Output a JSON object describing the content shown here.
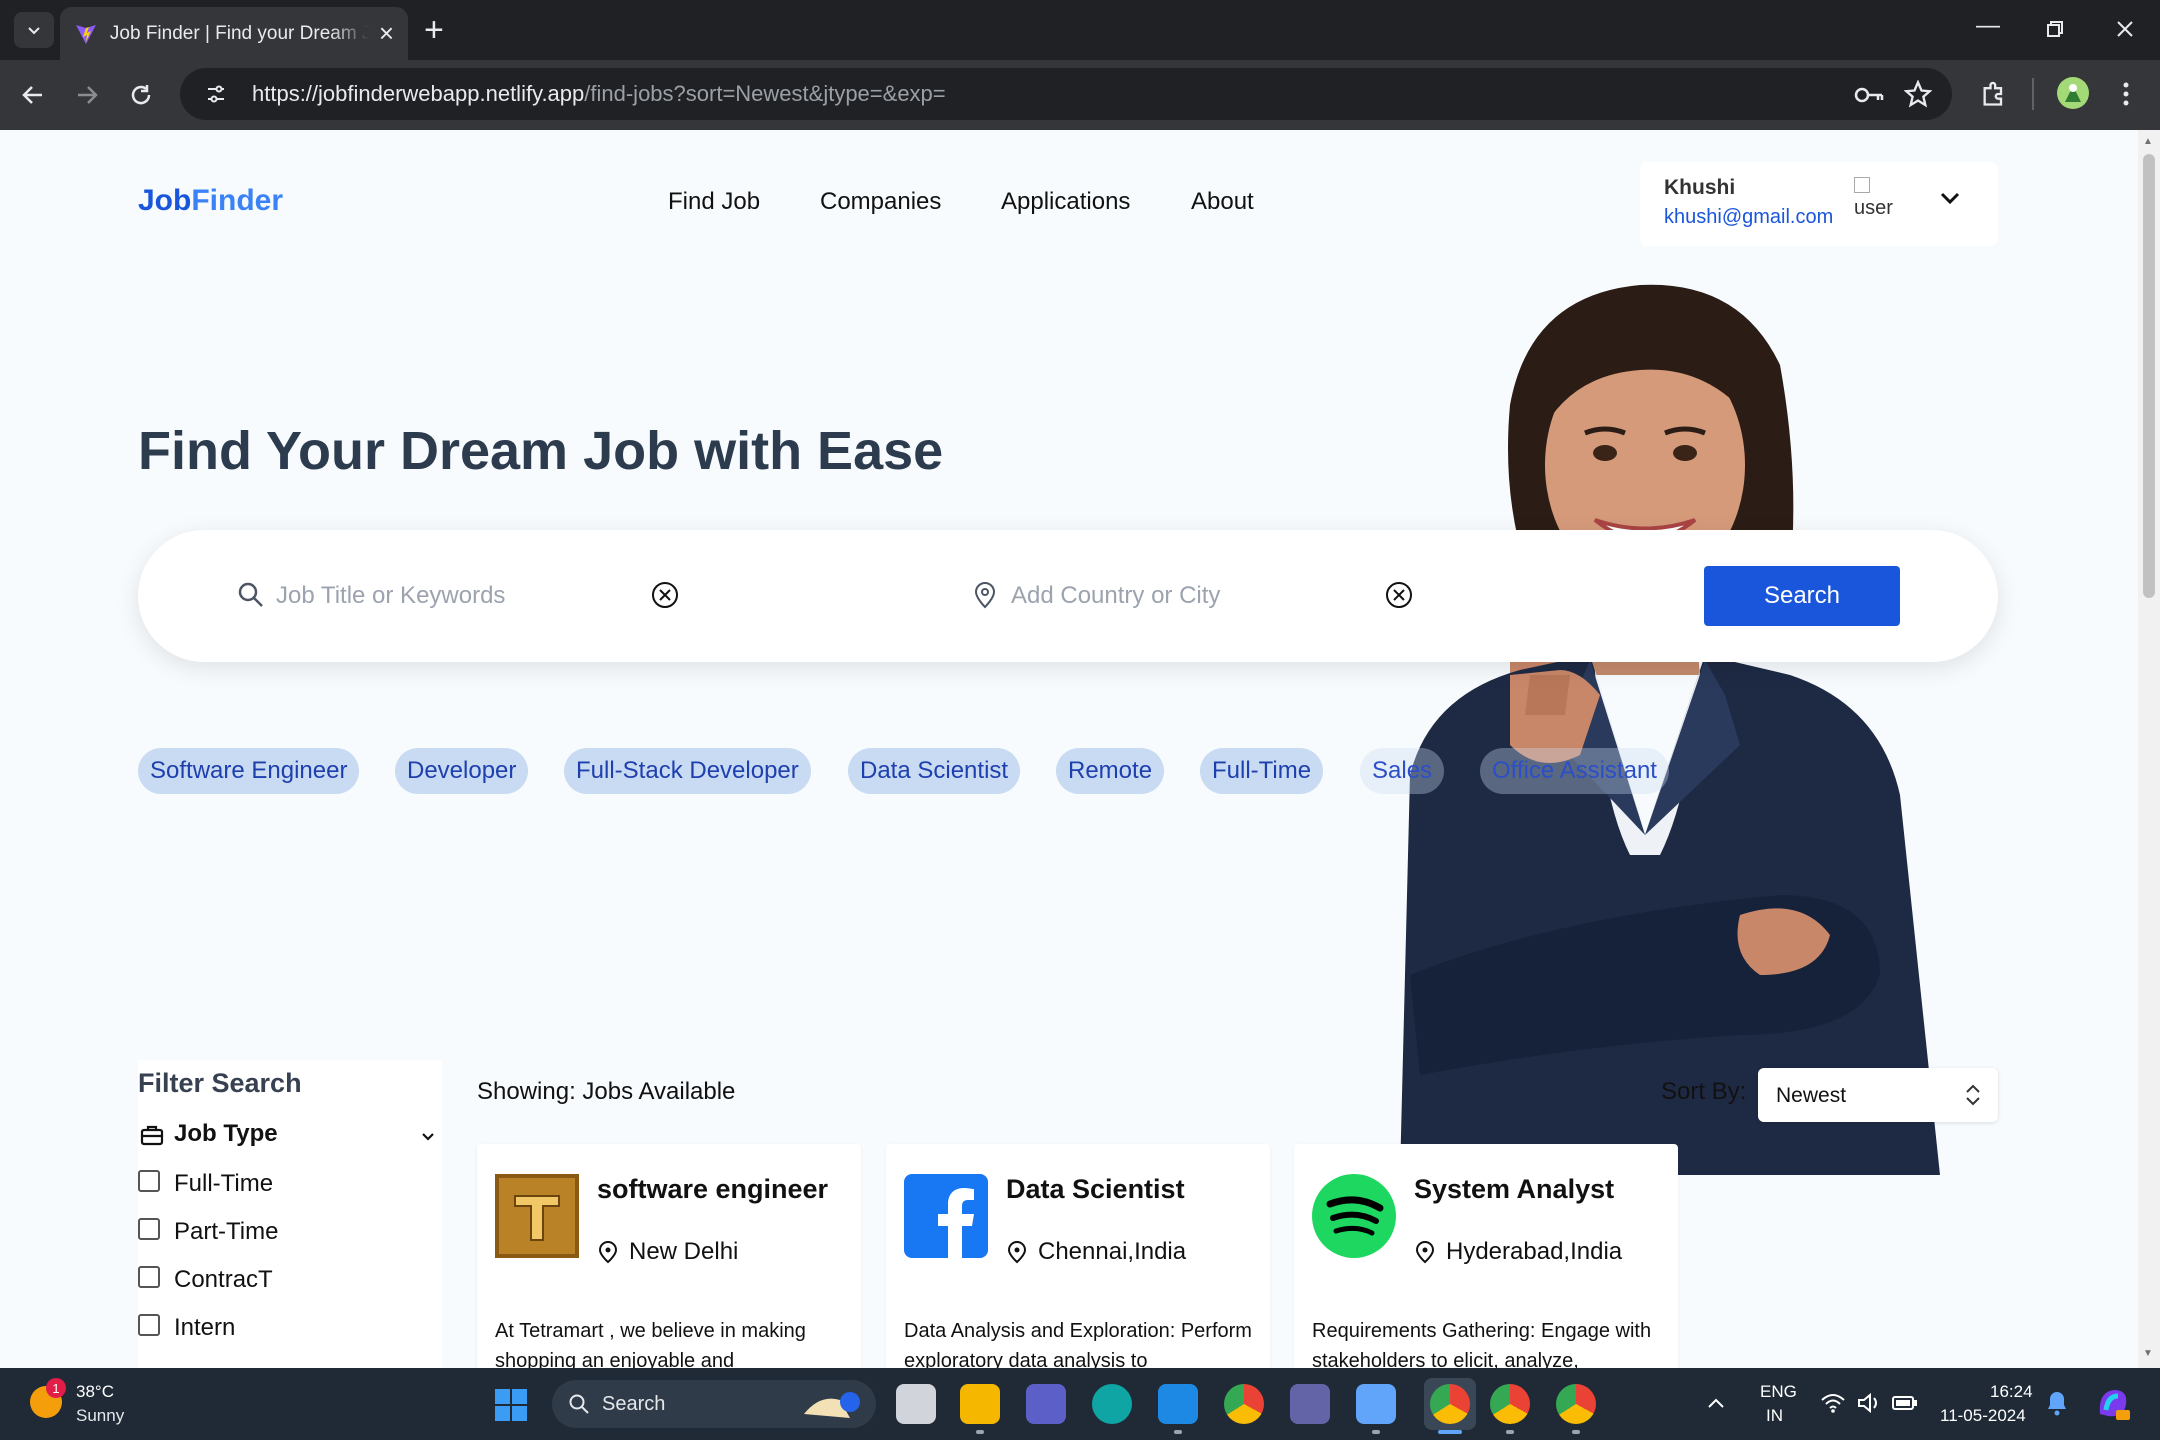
{
  "browser": {
    "tab_title": "Job Finder | Find your Dream Job",
    "new_tab_label": "+",
    "url_host": "https://jobfinderwebapp.netlify.app",
    "url_path": "/find-jobs?sort=Newest&jtype=&exp="
  },
  "header": {
    "logo_part1": "Job",
    "logo_part2": "Finder",
    "nav": [
      "Find Job",
      "Companies",
      "Applications",
      "About"
    ],
    "user": {
      "name": "Khushi",
      "email": "khushi@gmail.com",
      "avatar_alt": "user"
    }
  },
  "hero": {
    "title": "Find Your Dream Job with Ease",
    "search": {
      "keyword_placeholder": "Job Title or Keywords",
      "location_placeholder": "Add Country or City",
      "button_label": "Search"
    },
    "popular_tags": [
      "Software Engineer",
      "Developer",
      "Full-Stack Developer",
      "Data Scientist",
      "Remote",
      "Full-Time",
      "Sales",
      "Office Assistant"
    ]
  },
  "filters": {
    "title": "Filter Search",
    "job_type_label": "Job Type",
    "job_types": [
      "Full-Time",
      "Part-Time",
      "ContracT",
      "Intern"
    ]
  },
  "results": {
    "showing_label": "Showing: Jobs Available",
    "sort_label": "Sort By:",
    "sort_value": "Newest",
    "jobs": [
      {
        "title": "software engineer",
        "location": "New Delhi",
        "description": "At Tetramart , we believe in making shopping an enjoyable and",
        "logo": "tetramart-logo"
      },
      {
        "title": "Data Scientist",
        "location": "Chennai,India",
        "description": "Data Analysis and Exploration: Perform exploratory data analysis to",
        "logo": "facebook-logo"
      },
      {
        "title": "System Analyst",
        "location": "Hyderabad,India",
        "description": "Requirements Gathering: Engage with stakeholders to elicit, analyze,",
        "logo": "spotify-logo"
      }
    ]
  },
  "taskbar": {
    "weather_badge": "1",
    "weather_temp": "38°C",
    "weather_desc": "Sunny",
    "search_label": "Search",
    "lang_top": "ENG",
    "lang_bottom": "IN",
    "time": "16:24",
    "date": "11-05-2024"
  },
  "colors": {
    "brand_blue": "#1a56db",
    "chip_bg": "#c9dbf2",
    "page_bg": "#f7fbfd",
    "heading": "#2d3b4e"
  }
}
